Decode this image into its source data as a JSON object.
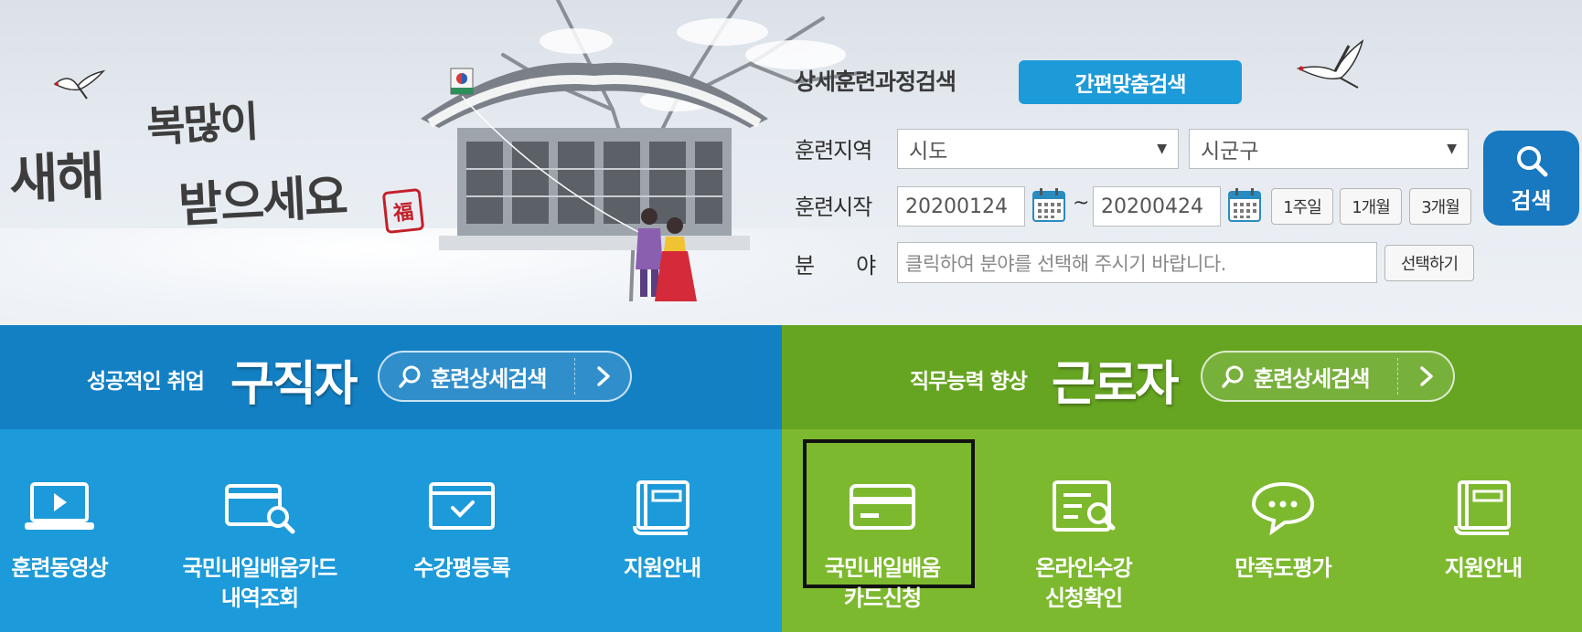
{
  "hero": {
    "greeting_line1": "복많이",
    "greeting_line2": "새해",
    "greeting_line3": "받으세요",
    "seal_text": "福"
  },
  "search": {
    "title": "상세훈련과정검색",
    "quick_search_label": "간편맞춤검색",
    "region_label": "훈련지역",
    "province_value": "시도",
    "district_value": "시군구",
    "start_label": "훈련시작",
    "start_date": "20200124",
    "tilde": "~",
    "end_date": "20200424",
    "period_buttons": [
      "1주일",
      "1개월",
      "3개월"
    ],
    "field_label": "분　　야",
    "field_placeholder": "클릭하여 분야를 선택해 주시기 바랍니다.",
    "select_button": "선택하기",
    "search_button": "검색"
  },
  "job_seeker": {
    "subtitle": "성공적인 취업",
    "title": "구직자",
    "detail_search": "훈련상세검색",
    "menu": [
      {
        "label": "훈련동영상",
        "icon": "video-play-icon"
      },
      {
        "label": "국민내일배움카드\n내역조회",
        "icon": "card-search-icon"
      },
      {
        "label": "수강평등록",
        "icon": "window-check-icon"
      },
      {
        "label": "지원안내",
        "icon": "book-icon"
      }
    ]
  },
  "worker": {
    "subtitle": "직무능력 향상",
    "title": "근로자",
    "detail_search": "훈련상세검색",
    "menu": [
      {
        "label": "국민내일배움\n카드신청",
        "icon": "credit-card-icon"
      },
      {
        "label": "온라인수강\n신청확인",
        "icon": "document-search-icon"
      },
      {
        "label": "만족도평가",
        "icon": "chat-bubble-icon"
      },
      {
        "label": "지원안내",
        "icon": "book-icon"
      }
    ]
  },
  "colors": {
    "job_seeker_bar": "#1480c4",
    "job_seeker_body": "#1d9ad9",
    "worker_bar": "#66a521",
    "worker_body": "#7db92e",
    "primary_button": "#1d9ad8",
    "search_button": "#1878c0"
  }
}
